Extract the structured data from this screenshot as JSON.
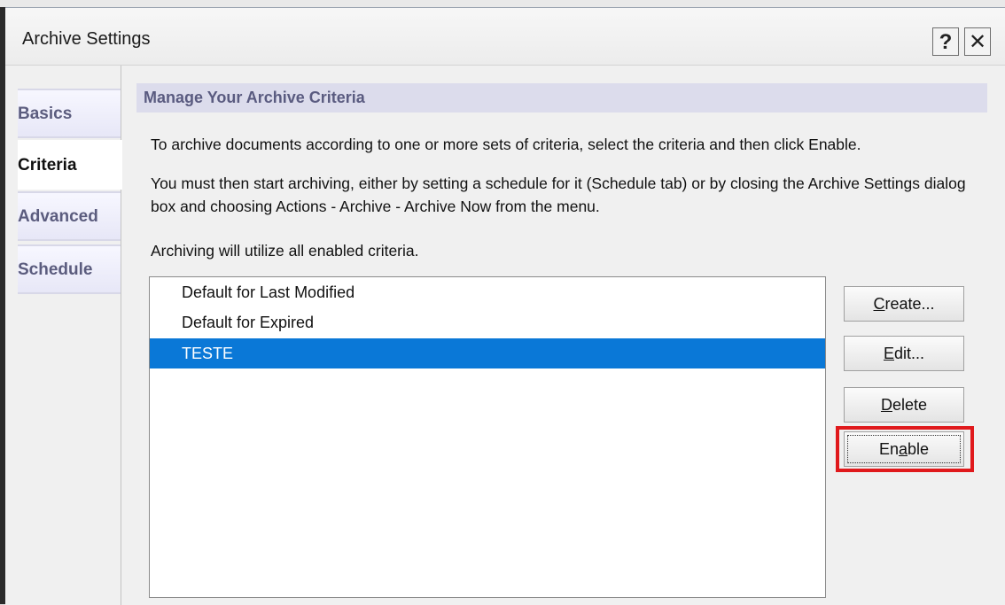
{
  "window": {
    "title": "Archive Settings"
  },
  "titlebar": {
    "help_label": "?",
    "close_label": "✕"
  },
  "tabs": [
    {
      "label": "Basics",
      "active": false
    },
    {
      "label": "Criteria",
      "active": true
    },
    {
      "label": "Advanced",
      "active": false
    },
    {
      "label": "Schedule",
      "active": false
    }
  ],
  "main": {
    "heading": "Manage Your Archive Criteria",
    "para1": "To archive documents according to one or more sets of criteria, select the criteria and then click Enable.",
    "para2": "You must then start archiving, either by setting a schedule for it (Schedule tab) or by closing the Archive Settings dialog box and choosing Actions - Archive - Archive Now from the menu.",
    "para3": "Archiving will utilize all enabled criteria."
  },
  "criteria_list": [
    {
      "label": "Default for Last Modified",
      "selected": false
    },
    {
      "label": "Default for Expired",
      "selected": false
    },
    {
      "label": "TESTE",
      "selected": true
    }
  ],
  "buttons": {
    "create": {
      "mnemonic": "C",
      "rest": "reate..."
    },
    "edit": {
      "mnemonic": "E",
      "rest": "dit..."
    },
    "delete": {
      "mnemonic": "D",
      "rest": "elete"
    },
    "enable": {
      "pre": "En",
      "mnemonic": "a",
      "rest": "ble"
    }
  },
  "colors": {
    "selection": "#0a78d7",
    "heading_bg": "#dcdcec",
    "tab_text": "#5b5c7e",
    "highlight": "#e0191c"
  }
}
